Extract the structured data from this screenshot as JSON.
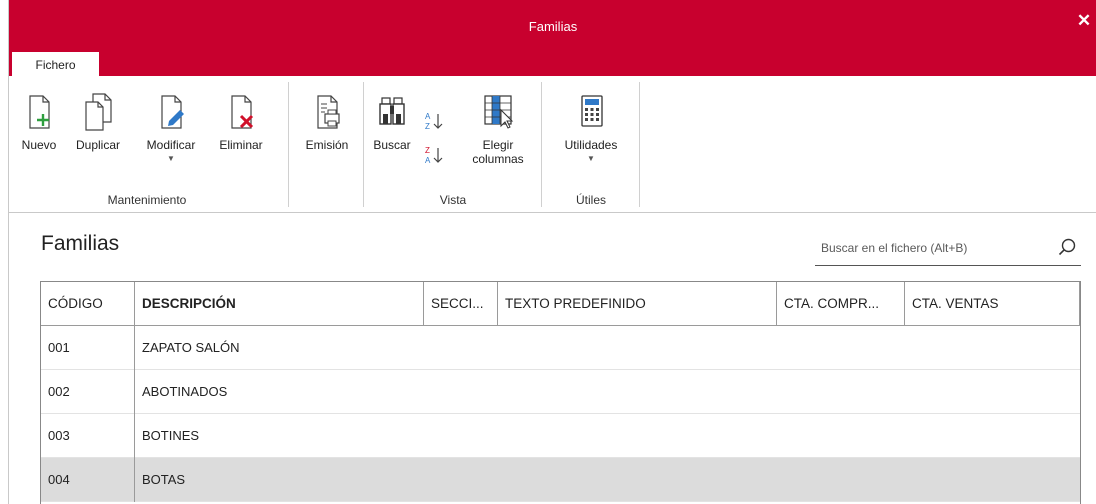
{
  "window": {
    "title": "Familias"
  },
  "ribbon": {
    "tab": "Fichero",
    "groups": {
      "mantenimiento": "Mantenimiento",
      "vista": "Vista",
      "utiles": "Útiles"
    },
    "buttons": {
      "nuevo": "Nuevo",
      "duplicar": "Duplicar",
      "modificar": "Modificar",
      "eliminar": "Eliminar",
      "emision": "Emisión",
      "buscar": "Buscar",
      "elegir_1": "Elegir",
      "elegir_2": "columnas",
      "utilidades": "Utilidades"
    }
  },
  "main": {
    "heading": "Familias",
    "search": {
      "placeholder": "Buscar en el fichero (Alt+B)"
    }
  },
  "table": {
    "columns": [
      "CÓDIGO",
      "DESCRIPCIÓN",
      "SECCI...",
      "TEXTO PREDEFINIDO",
      "CTA. COMPR...",
      "CTA. VENTAS"
    ],
    "rows": [
      {
        "codigo": "001",
        "descripcion": "ZAPATO SALÓN"
      },
      {
        "codigo": "002",
        "descripcion": "ABOTINADOS"
      },
      {
        "codigo": "003",
        "descripcion": "BOTINES"
      },
      {
        "codigo": "004",
        "descripcion": "BOTAS"
      }
    ],
    "selected_row": 3
  },
  "colors": {
    "accent": "#c8002e",
    "selected_row": "#dcdcdc",
    "icon_green": "#2e9e3e",
    "icon_red": "#d0102a",
    "icon_blue": "#2f79c8"
  }
}
